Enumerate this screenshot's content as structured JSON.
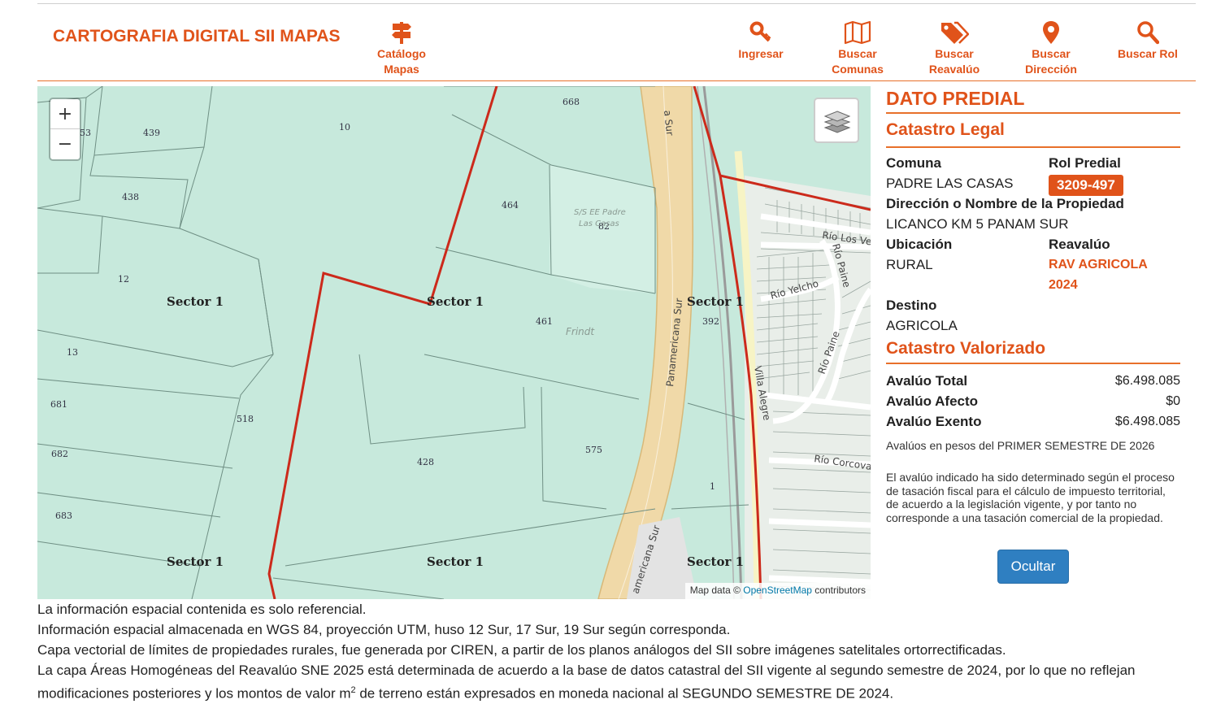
{
  "header": {
    "brand": "CARTOGRAFIA DIGITAL SII MAPAS",
    "nav": {
      "catalogo": "Catálogo\nMapas",
      "ingresar": "Ingresar",
      "comunas": "Buscar\nComunas",
      "reavaluo": "Buscar\nReavalúo",
      "direccion": "Buscar\nDirección",
      "rol": "Buscar Rol"
    }
  },
  "map": {
    "zoom_in": "+",
    "zoom_out": "−",
    "attribution_prefix": "Map data © ",
    "attribution_link": "OpenStreetMap",
    "attribution_suffix": " contributors",
    "labels": {
      "sector": "Sector 1",
      "road_label": "Panamericana Sur",
      "road_label_2": "americana Sur",
      "road_label_3": "a Sur",
      "street_villa_alegre": "Villa Alegre",
      "street_rio_los": "Río Los Ve",
      "street_rio_paine": "Río Paine",
      "street_rio_yelcho": "Río Yelcho",
      "street_rio_paine_2": "Río Paine",
      "street_rio_corcovado": "Río Corcova",
      "place_frindt": "Frindt",
      "place_se": "S/S EE Padre",
      "place_se_2": "Las Casas"
    },
    "parcels": [
      "668",
      "10",
      "53",
      "439",
      "438",
      "464",
      "82",
      "12",
      "461",
      "392",
      "13",
      "681",
      "518",
      "575",
      "682",
      "428",
      "1",
      "683"
    ]
  },
  "panel": {
    "title": "DATO PREDIAL",
    "legal": {
      "heading": "Catastro Legal",
      "comuna_label": "Comuna",
      "comuna_value": "PADRE LAS CASAS",
      "rol_label": "Rol Predial",
      "rol_value": "3209-497",
      "direccion_label": "Dirección o Nombre de la Propiedad",
      "direccion_value": "LICANCO KM 5 PANAM SUR",
      "ubicacion_label": "Ubicación",
      "ubicacion_value": "RURAL",
      "reavaluo_label": "Reavalúo",
      "reavaluo_value_1": "RAV AGRICOLA",
      "reavaluo_value_2": "2024",
      "destino_label": "Destino",
      "destino_value": "AGRICOLA"
    },
    "valorizado": {
      "heading": "Catastro Valorizado",
      "rows": [
        {
          "label": "Avalúo Total",
          "value": "$6.498.085"
        },
        {
          "label": "Avalúo Afecto",
          "value": "$0"
        },
        {
          "label": "Avalúo Exento",
          "value": "$6.498.085"
        }
      ],
      "note": "Avalúos en pesos del PRIMER SEMESTRE DE 2026",
      "disclaimer": "El avalúo indicado ha sido determinado según el proceso de tasación fiscal para el cálculo de impuesto territorial, de acuerdo a la legislación vigente, y por tanto no corresponde a una tasación comercial de la propiedad."
    },
    "button_hide": "Ocultar"
  },
  "footer": {
    "line1": "La información espacial contenida es solo referencial.",
    "line2": "Información espacial almacenada en WGS 84, proyección UTM, huso 12 Sur, 17 Sur, 19 Sur según corresponda.",
    "line3": "Capa vectorial de límites de propiedades rurales, fue generada por CIREN, a partir de los planos análogos del SII sobre imágenes satelitales ortorrectificadas.",
    "line4a": "La capa Áreas Homogéneas del Reavalúo SNE 2025 está determinada de acuerdo a la base de datos catastral del SII vigente al segundo semestre de 2024, por lo que no reflejan",
    "line4b_pre": "modificaciones posteriores y los montos de valor m",
    "line4b_sup": "2",
    "line4b_post": " de terreno están expresados en moneda nacional al SEGUNDO SEMESTRE DE 2024."
  },
  "colors": {
    "accent": "#e0531a",
    "map_bg": "#c7e9dc",
    "parcel_line": "#6f8f84",
    "selected_boundary": "#cc2a1b",
    "road": "#f0d9a8",
    "button": "#2f7fc1"
  }
}
